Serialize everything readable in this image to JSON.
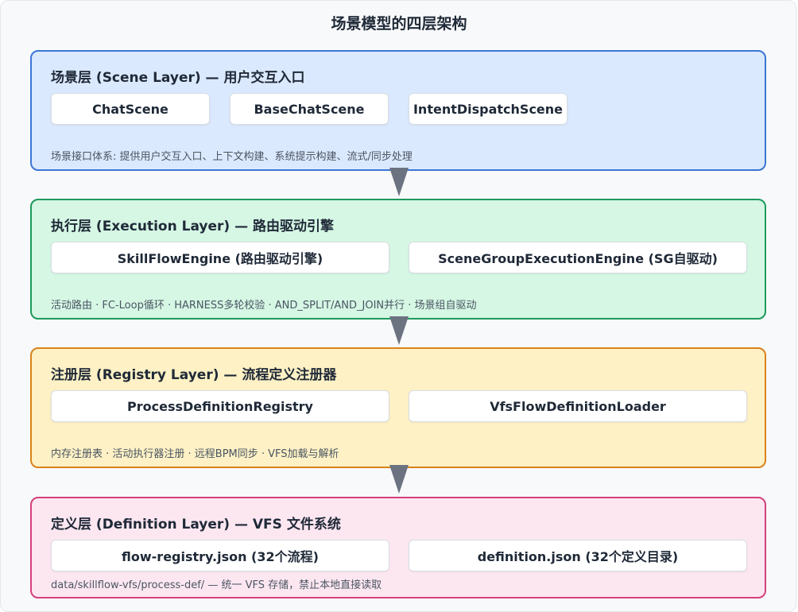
{
  "title": "场景模型的四层架构",
  "colors": {
    "scene_border": "#3b76d4",
    "scene_bg": "#dbe9fe",
    "execution_border": "#1f9a5c",
    "execution_bg": "#d5f7e4",
    "registry_border": "#d9821b",
    "registry_bg": "#fdf1c5",
    "definition_border": "#d5407d",
    "definition_bg": "#fce7f1",
    "arrow": "#6b7280"
  },
  "layers": [
    {
      "title": "场景层 (Scene Layer) — 用户交互入口",
      "boxes": [
        "ChatScene",
        "BaseChatScene",
        "IntentDispatchScene"
      ],
      "description": "场景接口体系: 提供用户交互入口、上下文构建、系统提示构建、流式/同步处理"
    },
    {
      "title": "执行层 (Execution Layer) — 路由驱动引擎",
      "boxes": [
        "SkillFlowEngine (路由驱动引擎)",
        "SceneGroupExecutionEngine (SG自驱动)"
      ],
      "description": "活动路由 · FC-Loop循环 · HARNESS多轮校验 · AND_SPLIT/AND_JOIN并行 · 场景组自驱动"
    },
    {
      "title": "注册层 (Registry Layer) — 流程定义注册器",
      "boxes": [
        "ProcessDefinitionRegistry",
        "VfsFlowDefinitionLoader"
      ],
      "description": "内存注册表 · 活动执行器注册 · 远程BPM同步 · VFS加载与解析"
    },
    {
      "title": "定义层 (Definition Layer) — VFS 文件系统",
      "boxes": [
        "flow-registry.json (32个流程)",
        "definition.json (32个定义目录)"
      ],
      "description": "data/skillflow-vfs/process-def/ — 统一 VFS 存储，禁止本地直接读取"
    }
  ]
}
